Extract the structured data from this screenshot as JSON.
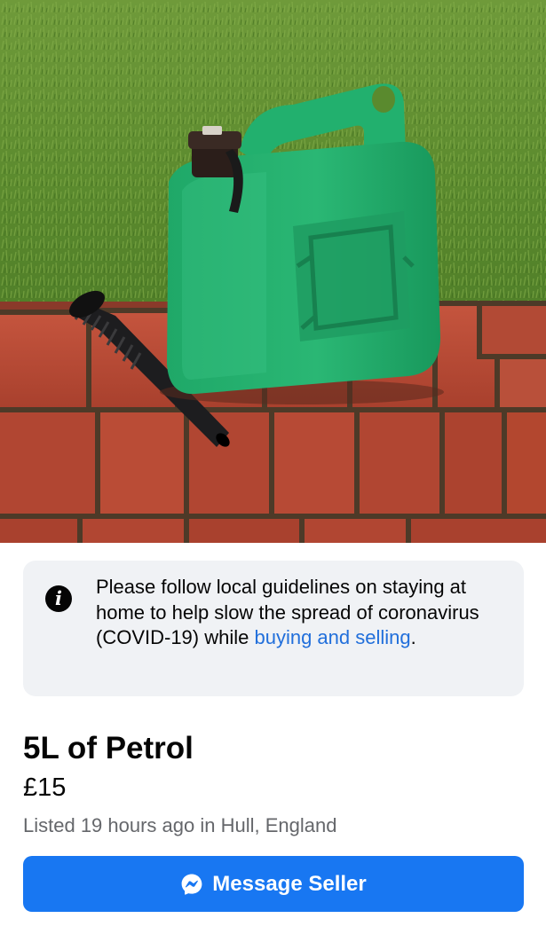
{
  "notice": {
    "icon": "info-icon",
    "text_before_link": "Please follow local guidelines on staying at home to help slow the spread of coronavirus (COVID-19) while ",
    "link_text": "buying and selling",
    "text_after_link": "."
  },
  "listing": {
    "title": "5L of Petrol",
    "price": "£15",
    "meta": "Listed 19 hours ago in Hull, England"
  },
  "actions": {
    "message_label": "Message Seller",
    "message_icon": "messenger-icon"
  },
  "colors": {
    "accent": "#1877f2",
    "link": "#216fdb",
    "notice_bg": "#f0f2f5",
    "secondary_text": "#65676b"
  }
}
